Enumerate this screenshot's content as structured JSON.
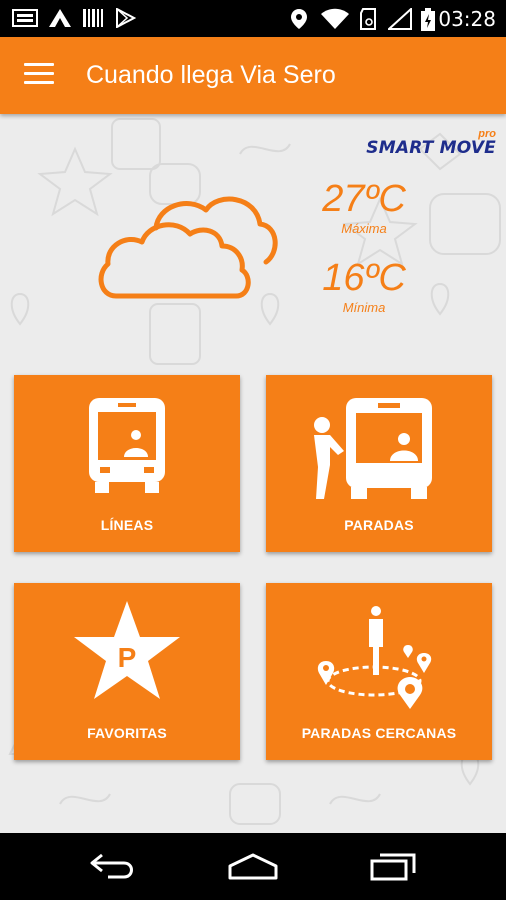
{
  "status_bar": {
    "time": "03:28",
    "icons": [
      "sim-card-icon",
      "notification-a-icon",
      "barcode-icon",
      "play-store-icon",
      "location-icon",
      "wifi-icon",
      "sim-icon",
      "signal-icon",
      "battery-icon"
    ]
  },
  "app_bar": {
    "title": "Cuando llega Via Sero",
    "menu_icon": "hamburger-menu-icon"
  },
  "logo": {
    "text": "SMART MOVE",
    "suffix": "pro"
  },
  "weather": {
    "icon": "cloud-icon",
    "max_value": "27ºC",
    "max_label": "Máxima",
    "min_value": "16ºC",
    "min_label": "Mínima"
  },
  "tiles": [
    {
      "label": "LÍNEAS",
      "icon": "bus-icon"
    },
    {
      "label": "PARADAS",
      "icon": "bus-stop-icon"
    },
    {
      "label": "FAVORITAS",
      "icon": "star-p-icon"
    },
    {
      "label": "PARADAS CERCANAS",
      "icon": "nearby-stops-icon"
    }
  ],
  "nav_bar": {
    "icons": [
      "back-icon",
      "home-icon",
      "recents-icon"
    ]
  },
  "colors": {
    "accent": "#f57f17",
    "brand_blue": "#1e2d8c",
    "background": "#ececec"
  }
}
